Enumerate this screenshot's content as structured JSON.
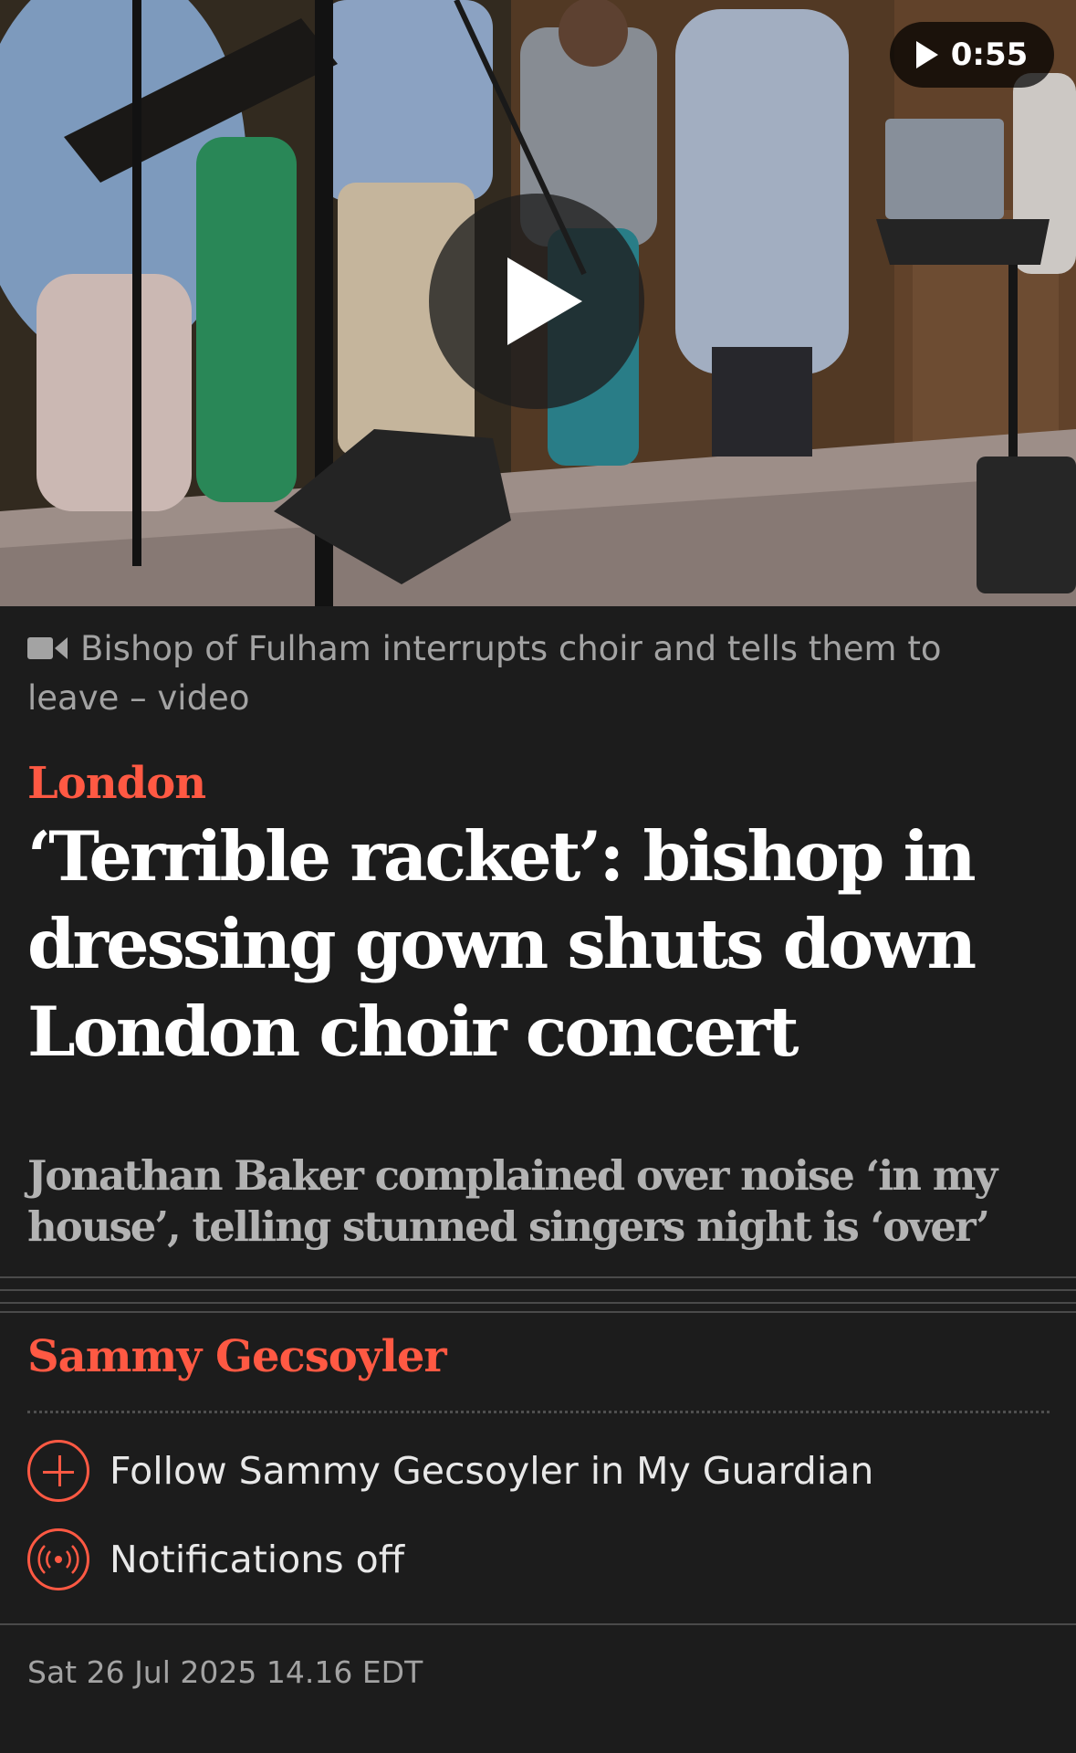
{
  "video": {
    "duration": "0:55",
    "caption": "Bishop of Fulham interrupts choir and tells them to leave – video"
  },
  "article": {
    "kicker": "London",
    "headline": "‘Terrible racket’: bishop in dressing gown shuts down London choir concert",
    "standfirst": "Jonathan Baker complained over noise ‘in my house’, telling stunned singers night is ‘over’",
    "author": "Sammy Gecsoyler",
    "follow_label": "Follow Sammy Gecsoyler in My Guardian",
    "notifications_label": "Notifications off",
    "dateline": "Sat 26 Jul 2025 14.16 EDT"
  },
  "icons": {
    "duration": "play-icon",
    "play": "play-icon",
    "caption": "video-camera-icon",
    "follow": "plus-circle-icon",
    "notifications": "broadcast-icon"
  },
  "colors": {
    "background": "#1c1c1c",
    "accent": "#ff5943",
    "headline": "#ffffff",
    "secondary_text": "#a3a3a3"
  }
}
